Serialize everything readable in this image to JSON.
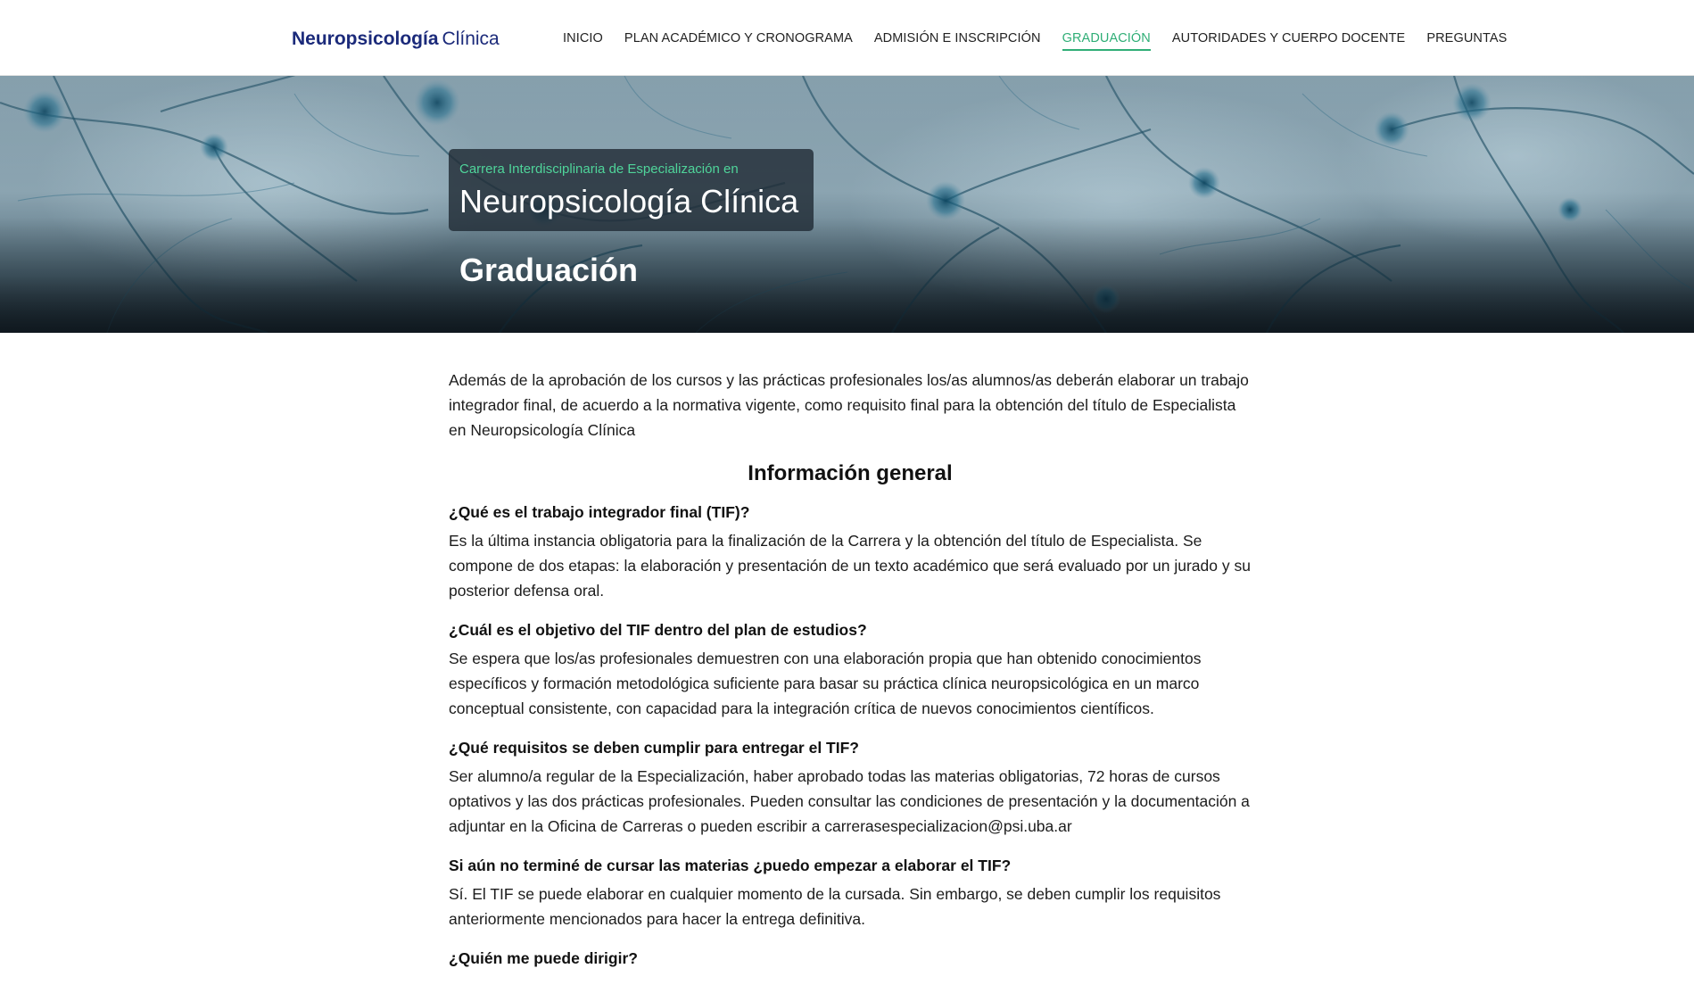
{
  "brand": {
    "bold": "Neuropsicología",
    "light": "Clínica"
  },
  "nav": [
    {
      "label": "INICIO",
      "active": false
    },
    {
      "label": "PLAN ACADÉMICO Y CRONOGRAMA",
      "active": false
    },
    {
      "label": "ADMISIÓN E INSCRIPCIÓN",
      "active": false
    },
    {
      "label": "GRADUACIÓN",
      "active": true
    },
    {
      "label": "AUTORIDADES Y CUERPO DOCENTE",
      "active": false
    },
    {
      "label": "PREGUNTAS",
      "active": false
    }
  ],
  "hero": {
    "subtitle": "Carrera Interdisciplinaria de Especialización en",
    "title": "Neuropsicología Clínica",
    "page_title": "Graduación"
  },
  "content": {
    "intro": "Además de la aprobación de los cursos y las prácticas profesionales los/as alumnos/as deberán elaborar un trabajo integrador final, de acuerdo a la normativa vigente, como requisito final para la obtención del título de Especialista en Neuropsicología Clínica",
    "section_title": "Información general",
    "faqs": [
      {
        "q": "¿Qué es el trabajo integrador final (TIF)?",
        "a": "Es la última instancia obligatoria para la finalización de la Carrera y la obtención del título de Especialista. Se compone de dos etapas: la elaboración y presentación de un texto académico que será evaluado por un jurado y su posterior defensa oral."
      },
      {
        "q": "¿Cuál es el objetivo del TIF dentro del plan de estudios?",
        "a": "Se espera que los/as profesionales demuestren con una elaboración propia que han obtenido conocimientos específicos y formación metodológica suficiente para basar su práctica clínica neuropsicológica en un marco conceptual consistente, con capacidad para la integración crítica de nuevos conocimientos científicos."
      },
      {
        "q": "¿Qué requisitos se deben cumplir para entregar el TIF?",
        "a": "Ser alumno/a regular de la Especialización, haber aprobado todas las materias obligatorias, 72 horas de cursos optativos y las dos prácticas profesionales. Pueden consultar las condiciones de presentación y la documentación a adjuntar en la Oficina de Carreras o pueden escribir a carrerasespecializacion@psi.uba.ar"
      },
      {
        "q": "Si aún no terminé de cursar las materias ¿puedo empezar a elaborar el TIF?",
        "a": "Sí. El TIF se puede elaborar en cualquier momento de la cursada. Sin embargo, se deben cumplir los requisitos anteriormente mencionados para hacer la entrega definitiva."
      },
      {
        "q": "¿Quién me puede dirigir?",
        "a": ""
      }
    ]
  },
  "colors": {
    "brand": "#1b2a7a",
    "accent": "#2fae76",
    "hero_subtitle": "#4fd49a",
    "hero_card": "#212c36"
  }
}
